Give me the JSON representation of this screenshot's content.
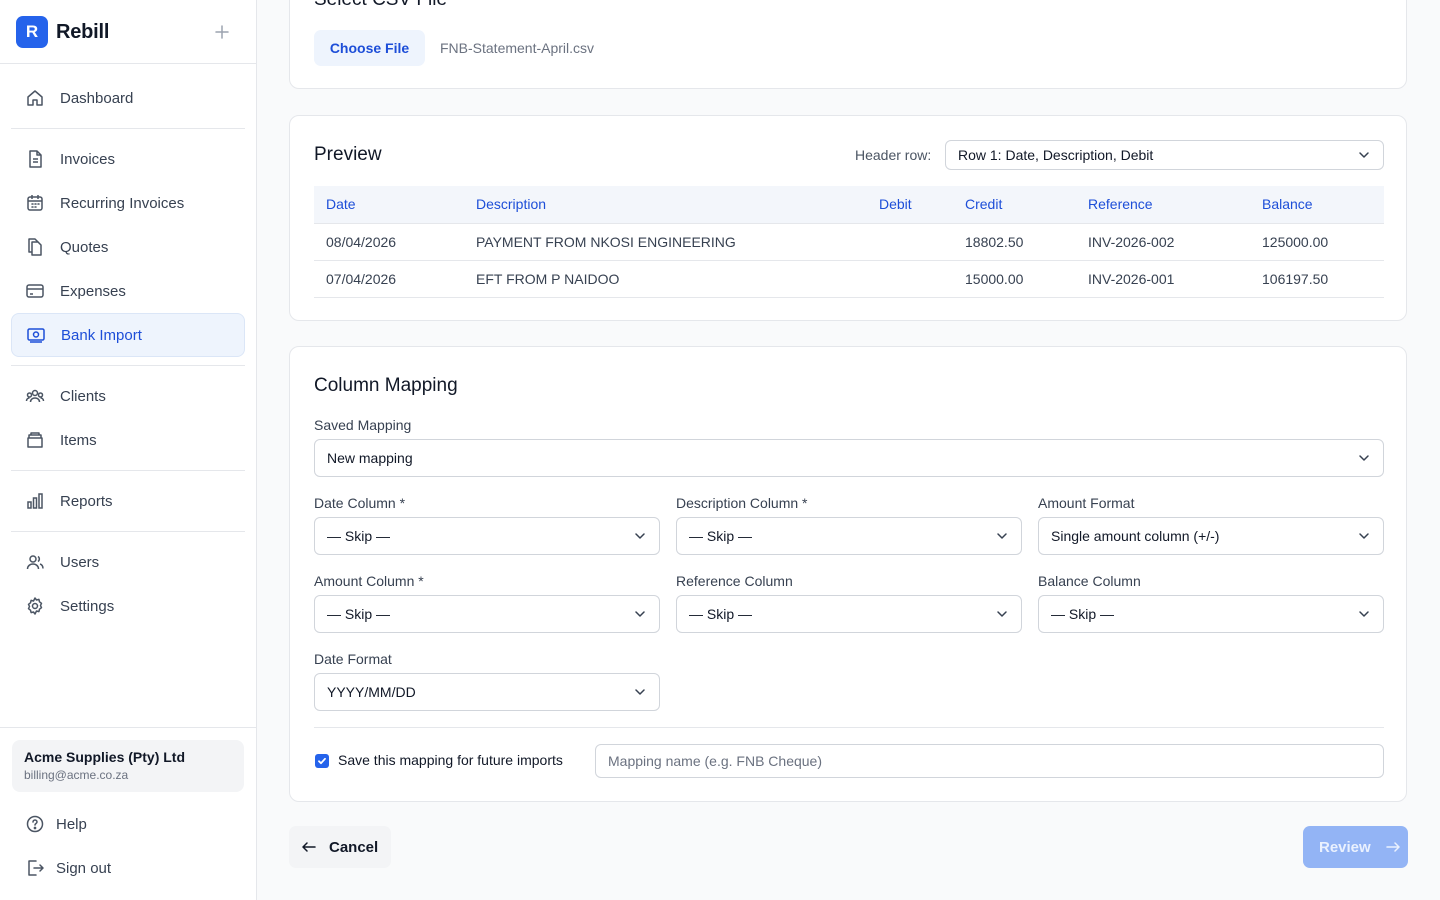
{
  "brand": {
    "logo_letter": "R",
    "name": "Rebill"
  },
  "sidebar": {
    "items": [
      {
        "label": "Dashboard",
        "icon": "home-icon"
      },
      {
        "label": "Invoices",
        "icon": "document-icon"
      },
      {
        "label": "Recurring Invoices",
        "icon": "calendar-icon"
      },
      {
        "label": "Quotes",
        "icon": "copy-icon"
      },
      {
        "label": "Expenses",
        "icon": "credit-card-icon"
      },
      {
        "label": "Bank Import",
        "icon": "banknote-icon",
        "active": true
      },
      {
        "label": "Clients",
        "icon": "users-icon"
      },
      {
        "label": "Items",
        "icon": "box-icon"
      },
      {
        "label": "Reports",
        "icon": "bar-chart-icon"
      },
      {
        "label": "Users",
        "icon": "user-group-icon"
      },
      {
        "label": "Settings",
        "icon": "gear-icon"
      }
    ],
    "account": {
      "name": "Acme Supplies (Pty) Ltd",
      "email": "billing@acme.co.za"
    },
    "footer": {
      "help": "Help",
      "sign_out": "Sign out"
    }
  },
  "file_section": {
    "title": "Select CSV File",
    "choose_label": "Choose File",
    "file_name": "FNB-Statement-April.csv"
  },
  "preview": {
    "title": "Preview",
    "header_row_label": "Header row:",
    "header_row_value": "Row 1: Date, Description, Debit",
    "columns": [
      "Date",
      "Description",
      "Debit",
      "Credit",
      "Reference",
      "Balance"
    ],
    "rows": [
      [
        "08/04/2026",
        "PAYMENT FROM NKOSI ENGINEERING",
        "",
        "18802.50",
        "INV-2026-002",
        "125000.00"
      ],
      [
        "07/04/2026",
        "EFT FROM P NAIDOO",
        "",
        "15000.00",
        "INV-2026-001",
        "106197.50"
      ]
    ]
  },
  "mapping": {
    "title": "Column Mapping",
    "saved_mapping": {
      "label": "Saved Mapping",
      "value": "New mapping"
    },
    "date_column": {
      "label": "Date Column *",
      "value": "— Skip —"
    },
    "description_column": {
      "label": "Description Column *",
      "value": "— Skip —"
    },
    "amount_format": {
      "label": "Amount Format",
      "value": "Single amount column (+/-)"
    },
    "amount_column": {
      "label": "Amount Column *",
      "value": "— Skip —"
    },
    "reference_column": {
      "label": "Reference Column",
      "value": "— Skip —"
    },
    "balance_column": {
      "label": "Balance Column",
      "value": "— Skip —"
    },
    "date_format": {
      "label": "Date Format",
      "value": "YYYY/MM/DD"
    },
    "save_checkbox_label": "Save this mapping for future imports",
    "save_checked": true,
    "mapping_name_placeholder": "Mapping name (e.g. FNB Cheque)"
  },
  "actions": {
    "cancel": "Cancel",
    "review": "Review"
  },
  "colors": {
    "accent": "#2563eb",
    "active_bg": "#eef4fd",
    "review_disabled": "#93b4f5"
  }
}
